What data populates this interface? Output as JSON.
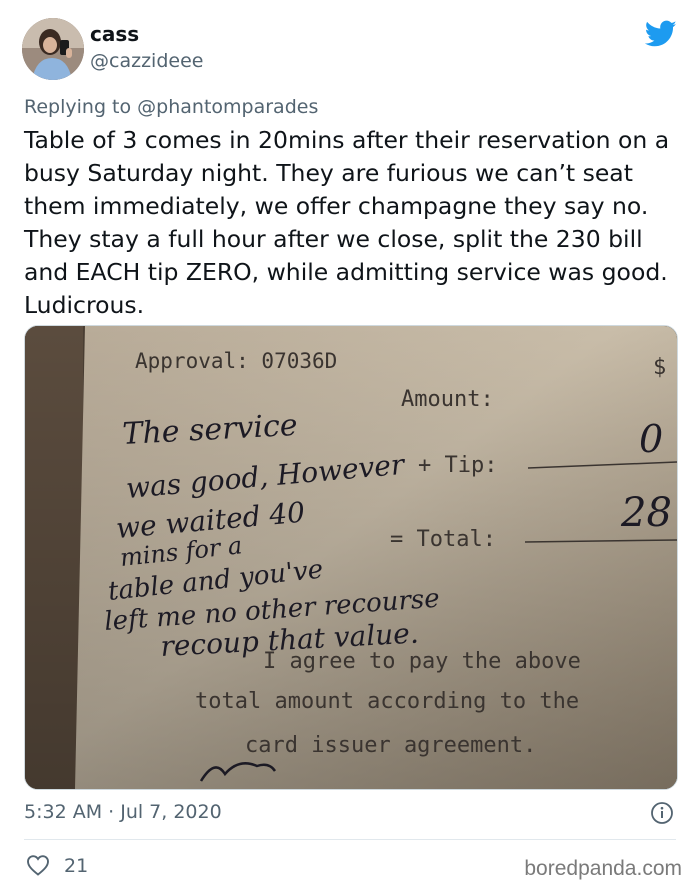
{
  "tweet": {
    "author_name": "cass",
    "author_handle": "@cazzideee",
    "replying_prefix": "Replying to",
    "replying_to": "@phantomparades",
    "text": "Table of 3 comes in 20mins after their reservation on a busy Saturday night. They are furious we can’t seat them immediately, we offer champagne they say no. They stay a full hour after we close, split the 230 bill and EACH tip ZERO, while admitting service was good. Ludicrous.",
    "timestamp": "5:32 AM · Jul 7, 2020",
    "like_count": "21",
    "brand_color": "#1d9bf0"
  },
  "receipt": {
    "approval": "Approval: 07036D",
    "amount_label": "Amount:",
    "tip_label": "+ Tip:",
    "total_label": "= Total:",
    "dollar": "$",
    "tip_value": "0",
    "total_value": "28",
    "agreement_line1": "I agree to pay the above",
    "agreement_line2": "total amount according to the",
    "agreement_line3": "card issuer agreement.",
    "handwriting": [
      "The service",
      "was good, However",
      "we waited 40",
      "mins for a",
      "table and you've",
      "left me no other recourse",
      "recoup that value."
    ]
  },
  "footer": {
    "watermark": "boredpanda.com"
  }
}
